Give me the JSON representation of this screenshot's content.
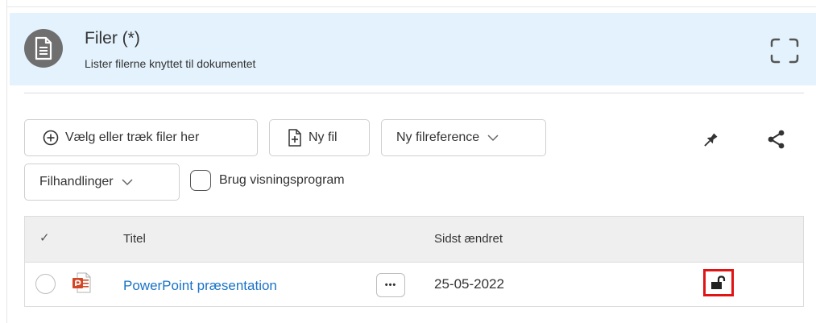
{
  "header": {
    "title": "Filer (*)",
    "subtitle": "Lister filerne knyttet til dokumentet"
  },
  "toolbar": {
    "choose_files_label": "Vælg eller træk filer her",
    "new_file_label": "Ny fil",
    "new_reference_label": "Ny filreference",
    "file_actions_label": "Filhandlinger",
    "use_viewer_label": "Brug visningsprogram"
  },
  "table": {
    "check_header": "✓",
    "columns": [
      "Titel",
      "Sidst ændret"
    ],
    "rows": [
      {
        "title": "PowerPoint præsentation",
        "modified": "25-05-2022",
        "more": "•••"
      }
    ]
  },
  "colors": {
    "header_bg": "#e3f2fc",
    "link": "#1a73c7",
    "highlight": "#e01414"
  },
  "icons": [
    "document-icon",
    "expand-icon",
    "plus-circle-icon",
    "new-file-icon",
    "chevron-down-icon",
    "pin-icon",
    "share-icon",
    "powerpoint-icon",
    "unlocked-icon"
  ]
}
